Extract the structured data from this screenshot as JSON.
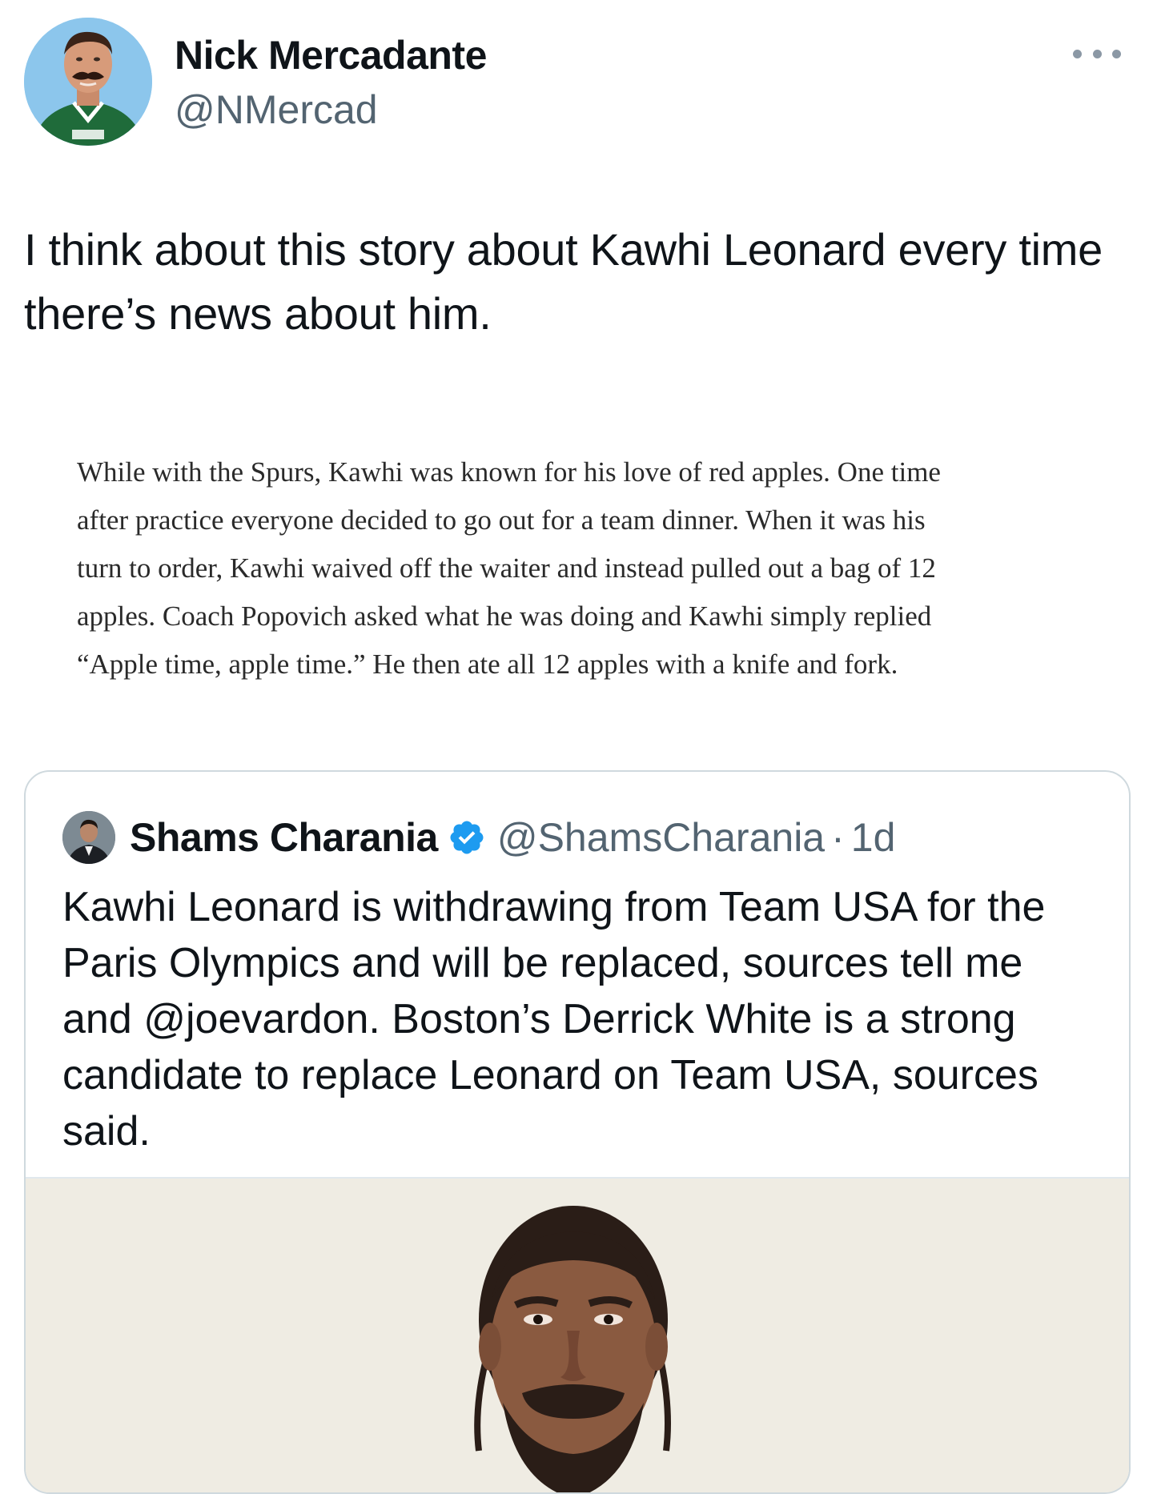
{
  "tweet": {
    "author_name": "Nick Mercadante",
    "author_handle": "@NMercad",
    "text": "I think about this story about Kawhi Leonard every time there’s news about him.",
    "more_icon": "more-horizontal-icon"
  },
  "excerpt": {
    "lines": [
      "While with the Spurs, Kawhi was known for his love of red apples. One time",
      "after practice everyone decided to go out for a team dinner. When it was his",
      "turn to order, Kawhi waived off the waiter and instead pulled out a bag of 12",
      "apples. Coach Popovich asked what he was doing and Kawhi simply replied",
      "“Apple time, apple time.” He then ate all 12 apples with a knife and fork."
    ]
  },
  "quoted_tweet": {
    "author_name": "Shams Charania",
    "verified_icon": "verified-badge-icon",
    "author_handle": "@ShamsCharania",
    "separator": "·",
    "time": "1d",
    "text": "Kawhi Leonard is withdrawing from Team USA for the Paris Olympics and will be replaced, sources tell me and @joevardon. Boston’s Derrick White is a strong candidate to replace Leonard on Team USA, sources said."
  },
  "colors": {
    "text_primary": "#0f1419",
    "text_secondary": "#536471",
    "border": "#cfd9de",
    "verified_blue": "#1d9bf0",
    "media_background": "#efece3"
  }
}
